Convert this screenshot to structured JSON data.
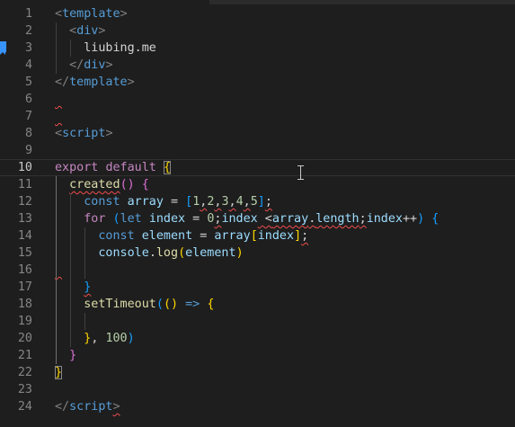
{
  "editor": {
    "lines": [
      {
        "n": "1",
        "tokens": [
          {
            "t": "<",
            "c": "t-punct"
          },
          {
            "t": "template",
            "c": "t-tag"
          },
          {
            "t": ">",
            "c": "t-punct"
          }
        ]
      },
      {
        "n": "2",
        "tokens": [
          {
            "t": "  ",
            "c": "t-text"
          },
          {
            "t": "<",
            "c": "t-punct"
          },
          {
            "t": "div",
            "c": "t-tag"
          },
          {
            "t": ">",
            "c": "t-punct"
          }
        ]
      },
      {
        "n": "3",
        "tokens": [
          {
            "t": "    liubing.me",
            "c": "t-text"
          }
        ]
      },
      {
        "n": "4",
        "tokens": [
          {
            "t": "  ",
            "c": "t-text"
          },
          {
            "t": "</",
            "c": "t-punct"
          },
          {
            "t": "div",
            "c": "t-tag"
          },
          {
            "t": ">",
            "c": "t-punct"
          }
        ]
      },
      {
        "n": "5",
        "tokens": [
          {
            "t": "</",
            "c": "t-punct"
          },
          {
            "t": "template",
            "c": "t-tag"
          },
          {
            "t": ">",
            "c": "t-punct"
          }
        ]
      },
      {
        "n": "6",
        "tokens": [
          {
            "t": " ",
            "c": "t-text squiggle"
          }
        ]
      },
      {
        "n": "7",
        "tokens": [
          {
            "t": " ",
            "c": "t-text squiggle"
          }
        ]
      },
      {
        "n": "8",
        "tokens": [
          {
            "t": "<",
            "c": "t-punct"
          },
          {
            "t": "script",
            "c": "t-tag"
          },
          {
            "t": ">",
            "c": "t-punct"
          }
        ]
      },
      {
        "n": "9",
        "tokens": []
      },
      {
        "n": "10",
        "tokens": [
          {
            "t": "export",
            "c": "t-ctrl"
          },
          {
            "t": " ",
            "c": "t-text"
          },
          {
            "t": "default",
            "c": "t-ctrl"
          },
          {
            "t": " ",
            "c": "t-text"
          },
          {
            "t": "{",
            "c": "t-bracket1 bracket-box"
          }
        ]
      },
      {
        "n": "11",
        "tokens": [
          {
            "t": "  ",
            "c": "t-text"
          },
          {
            "t": "created",
            "c": "t-fn squiggle"
          },
          {
            "t": "()",
            "c": "t-bracket2"
          },
          {
            "t": " ",
            "c": "t-text"
          },
          {
            "t": "{",
            "c": "t-bracket2"
          }
        ]
      },
      {
        "n": "12",
        "tokens": [
          {
            "t": "    ",
            "c": "t-text"
          },
          {
            "t": "const",
            "c": "t-kw"
          },
          {
            "t": " ",
            "c": "t-text"
          },
          {
            "t": "array",
            "c": "t-var"
          },
          {
            "t": " = ",
            "c": "t-text"
          },
          {
            "t": "[",
            "c": "t-bracket3"
          },
          {
            "t": "1",
            "c": "t-num"
          },
          {
            "t": ",",
            "c": "t-text squiggle"
          },
          {
            "t": "2",
            "c": "t-num"
          },
          {
            "t": ",",
            "c": "t-text squiggle"
          },
          {
            "t": "3",
            "c": "t-num"
          },
          {
            "t": ",",
            "c": "t-text squiggle"
          },
          {
            "t": "4",
            "c": "t-num"
          },
          {
            "t": ",",
            "c": "t-text squiggle"
          },
          {
            "t": "5",
            "c": "t-num"
          },
          {
            "t": "]",
            "c": "t-bracket3"
          },
          {
            "t": ";",
            "c": "t-text squiggle"
          }
        ]
      },
      {
        "n": "13",
        "tokens": [
          {
            "t": "    ",
            "c": "t-text"
          },
          {
            "t": "for",
            "c": "t-ctrl"
          },
          {
            "t": " ",
            "c": "t-text"
          },
          {
            "t": "(",
            "c": "t-bracket3"
          },
          {
            "t": "let",
            "c": "t-kw"
          },
          {
            "t": " ",
            "c": "t-text"
          },
          {
            "t": "index",
            "c": "t-var"
          },
          {
            "t": " = ",
            "c": "t-text"
          },
          {
            "t": "0",
            "c": "t-num"
          },
          {
            "t": ";",
            "c": "t-text squiggle"
          },
          {
            "t": "index",
            "c": "t-var"
          },
          {
            "t": " <",
            "c": "t-text squiggle"
          },
          {
            "t": "array",
            "c": "t-var squiggle"
          },
          {
            "t": ".",
            "c": "t-text squiggle"
          },
          {
            "t": "length",
            "c": "t-var squiggle"
          },
          {
            "t": ";",
            "c": "t-text squiggle"
          },
          {
            "t": "index",
            "c": "t-var"
          },
          {
            "t": "++",
            "c": "t-text"
          },
          {
            "t": ")",
            "c": "t-bracket3"
          },
          {
            "t": " ",
            "c": "t-text"
          },
          {
            "t": "{",
            "c": "t-bracket3"
          }
        ]
      },
      {
        "n": "14",
        "tokens": [
          {
            "t": "      ",
            "c": "t-text"
          },
          {
            "t": "const",
            "c": "t-kw"
          },
          {
            "t": " ",
            "c": "t-text"
          },
          {
            "t": "element",
            "c": "t-var"
          },
          {
            "t": " = ",
            "c": "t-text"
          },
          {
            "t": "array",
            "c": "t-var"
          },
          {
            "t": "[",
            "c": "t-bracket1"
          },
          {
            "t": "index",
            "c": "t-var"
          },
          {
            "t": "]",
            "c": "t-bracket1"
          },
          {
            "t": ";",
            "c": "t-text squiggle"
          }
        ]
      },
      {
        "n": "15",
        "tokens": [
          {
            "t": "      ",
            "c": "t-text"
          },
          {
            "t": "console",
            "c": "t-var"
          },
          {
            "t": ".",
            "c": "t-text"
          },
          {
            "t": "log",
            "c": "t-fn"
          },
          {
            "t": "(",
            "c": "t-bracket1"
          },
          {
            "t": "element",
            "c": "t-var"
          },
          {
            "t": ")",
            "c": "t-bracket1"
          }
        ]
      },
      {
        "n": "16",
        "tokens": [
          {
            "t": " ",
            "c": "t-text squiggle"
          }
        ]
      },
      {
        "n": "17",
        "tokens": [
          {
            "t": "    ",
            "c": "t-text"
          },
          {
            "t": "}",
            "c": "t-bracket3 squiggle"
          }
        ]
      },
      {
        "n": "18",
        "tokens": [
          {
            "t": "    ",
            "c": "t-text"
          },
          {
            "t": "setTimeout",
            "c": "t-fn"
          },
          {
            "t": "(",
            "c": "t-bracket3"
          },
          {
            "t": "()",
            "c": "t-bracket1"
          },
          {
            "t": " ",
            "c": "t-text"
          },
          {
            "t": "=>",
            "c": "t-kw"
          },
          {
            "t": " ",
            "c": "t-text"
          },
          {
            "t": "{",
            "c": "t-bracket1"
          }
        ]
      },
      {
        "n": "19",
        "tokens": []
      },
      {
        "n": "20",
        "tokens": [
          {
            "t": "    ",
            "c": "t-text"
          },
          {
            "t": "}",
            "c": "t-bracket1"
          },
          {
            "t": ", ",
            "c": "t-text"
          },
          {
            "t": "100",
            "c": "t-num"
          },
          {
            "t": ")",
            "c": "t-bracket3"
          }
        ]
      },
      {
        "n": "21",
        "tokens": [
          {
            "t": "  ",
            "c": "t-text"
          },
          {
            "t": "}",
            "c": "t-bracket2"
          }
        ]
      },
      {
        "n": "22",
        "tokens": [
          {
            "t": "}",
            "c": "t-bracket1 bracket-box"
          }
        ]
      },
      {
        "n": "23",
        "tokens": []
      },
      {
        "n": "24",
        "tokens": [
          {
            "t": "</",
            "c": "t-punct"
          },
          {
            "t": "script",
            "c": "t-tag"
          },
          {
            "t": ">",
            "c": "t-punct squiggle"
          }
        ]
      }
    ],
    "active_line": "10",
    "bookmark_line": "3",
    "colors": {
      "background": "#1e1e1e",
      "keyword": "#569cd6",
      "control": "#c586c0",
      "function": "#dcdcaa",
      "variable": "#9cdcfe",
      "number": "#b5cea8",
      "error": "#f14c4c"
    }
  }
}
